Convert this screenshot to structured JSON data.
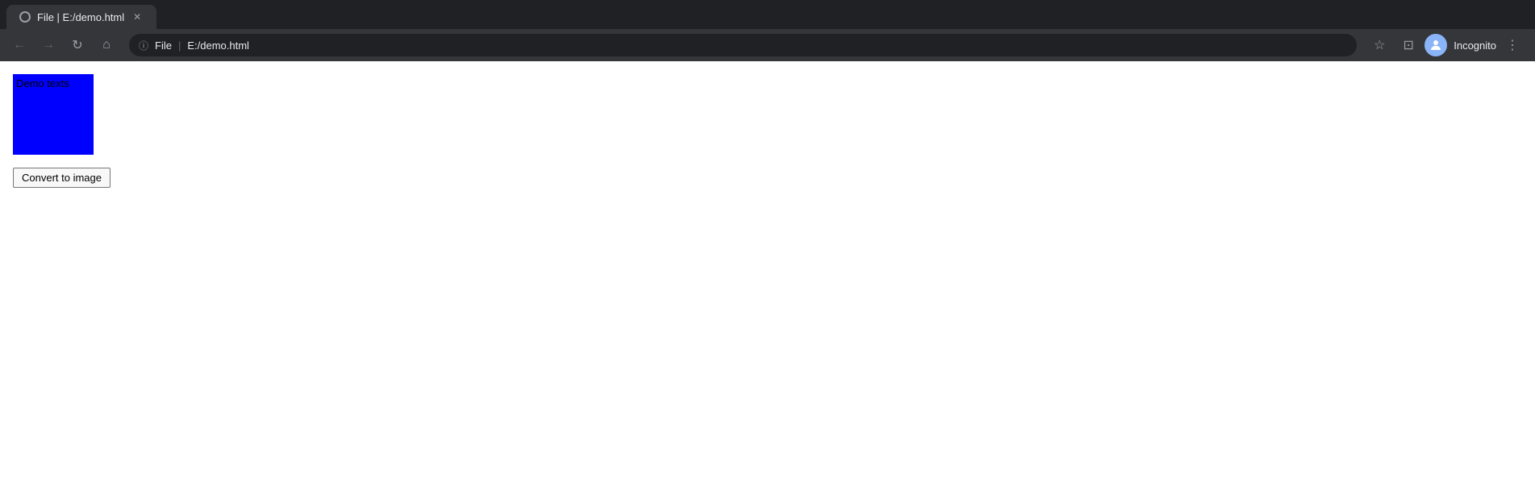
{
  "browser": {
    "tab": {
      "title": "File | E:/demo.html",
      "favicon_label": "file-icon"
    },
    "nav": {
      "back_label": "←",
      "forward_label": "→",
      "refresh_label": "↻",
      "home_label": "⌂",
      "address_scheme": "File",
      "address_separator": "|",
      "address_url": "E:/demo.html",
      "star_label": "☆",
      "tabswitch_label": "⊡",
      "profile_initials": "",
      "profile_name": "Incognito",
      "menu_label": "⋮"
    }
  },
  "page": {
    "demo_box": {
      "text": "Demo texts",
      "bg_color": "#0000ff"
    },
    "convert_button_label": "Convert to image"
  }
}
